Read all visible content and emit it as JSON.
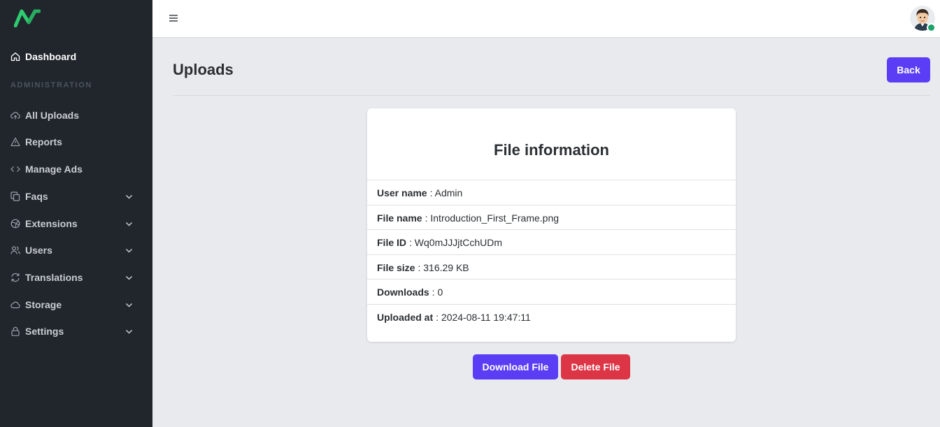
{
  "sidebar": {
    "dashboard": "Dashboard",
    "section_label": "ADMINISTRATION",
    "items": [
      {
        "label": "All Uploads"
      },
      {
        "label": "Reports"
      },
      {
        "label": "Manage Ads"
      },
      {
        "label": "Faqs"
      },
      {
        "label": "Extensions"
      },
      {
        "label": "Users"
      },
      {
        "label": "Translations"
      },
      {
        "label": "Storage"
      },
      {
        "label": "Settings"
      }
    ]
  },
  "header": {
    "title": "Uploads",
    "back_label": "Back"
  },
  "card": {
    "title": "File information",
    "rows": [
      {
        "key": "User name",
        "value": ": Admin"
      },
      {
        "key": "File name",
        "value": ": Introduction_First_Frame.png"
      },
      {
        "key": "File ID",
        "value": ": Wq0mJJJjtCchUDm"
      },
      {
        "key": "File size",
        "value": ": 316.29 KB"
      },
      {
        "key": "Downloads",
        "value": ": 0"
      },
      {
        "key": "Uploaded at",
        "value": ": 2024-08-11 19:47:11"
      }
    ]
  },
  "actions": {
    "download_label": "Download File",
    "delete_label": "Delete File"
  },
  "colors": {
    "sidebar_bg": "#21262c",
    "accent": "#5b3df5",
    "danger": "#dc3545",
    "logo_green": "#2ecc71",
    "status_online": "#1aa367"
  },
  "icons": {
    "logo": "brand-logo",
    "menu": "hamburger-icon",
    "avatar": "user-avatar"
  }
}
